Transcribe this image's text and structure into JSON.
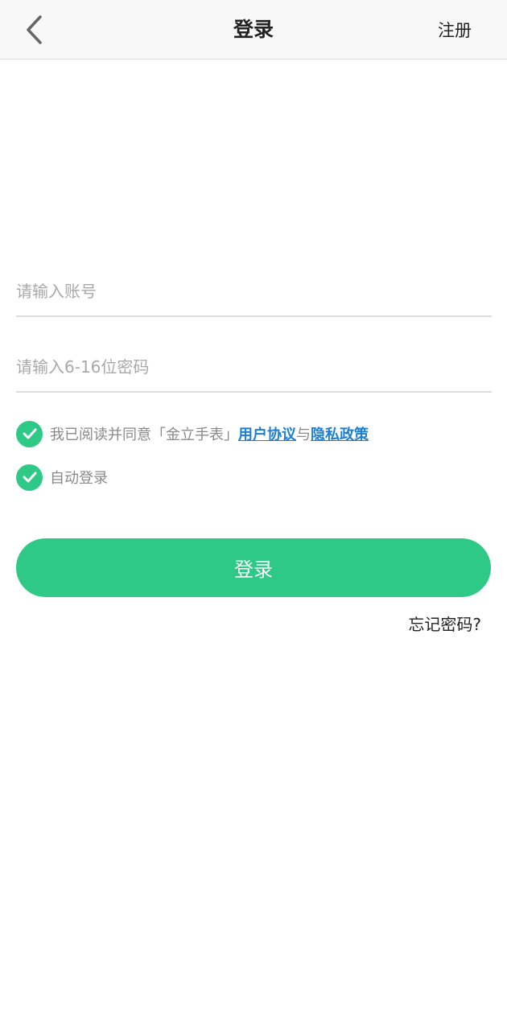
{
  "header": {
    "title": "登录",
    "register_label": "注册",
    "back_icon": "chevron-left-icon"
  },
  "form": {
    "account_placeholder": "请输入账号",
    "account_value": "",
    "password_placeholder": "请输入6-16位密码",
    "password_value": ""
  },
  "agreement": {
    "checked": true,
    "prefix": "我已阅读并同意「金立手表」",
    "user_agreement_label": "用户协议",
    "conjunction": "与",
    "privacy_policy_label": "隐私政策"
  },
  "auto_login": {
    "checked": true,
    "label": "自动登录"
  },
  "login_button_label": "登录",
  "forgot_password_label": "忘记密码?",
  "colors": {
    "accent": "#2ec986",
    "link": "#1e7ecf",
    "header_bg": "#f8f8f8"
  }
}
